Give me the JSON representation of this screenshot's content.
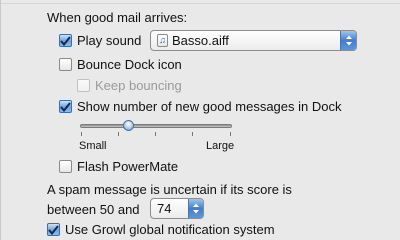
{
  "section_heading": "When good mail arrives:",
  "play_sound": {
    "label": "Play sound",
    "checked": true
  },
  "sound_popup": {
    "selected": "Basso.aiff",
    "icon": "music-note-icon"
  },
  "bounce_dock": {
    "label": "Bounce Dock icon",
    "checked": false
  },
  "keep_bouncing": {
    "label": "Keep bouncing",
    "checked": false,
    "enabled": false
  },
  "show_count": {
    "label": "Show number of new good messages in Dock",
    "checked": true
  },
  "count_slider": {
    "min_label": "Small",
    "max_label": "Large",
    "value_fraction": 0.32
  },
  "flash_powermate": {
    "label": "Flash PowerMate",
    "checked": false
  },
  "spam_text_line1": "A spam message is uncertain if its score is",
  "spam_text_line2": "between 50 and",
  "spam_threshold": {
    "value": "74"
  },
  "growl": {
    "label": "Use Growl global notification system",
    "checked": true
  },
  "colors": {
    "accent": "#5b97dd",
    "background": "#e9e9e9"
  }
}
